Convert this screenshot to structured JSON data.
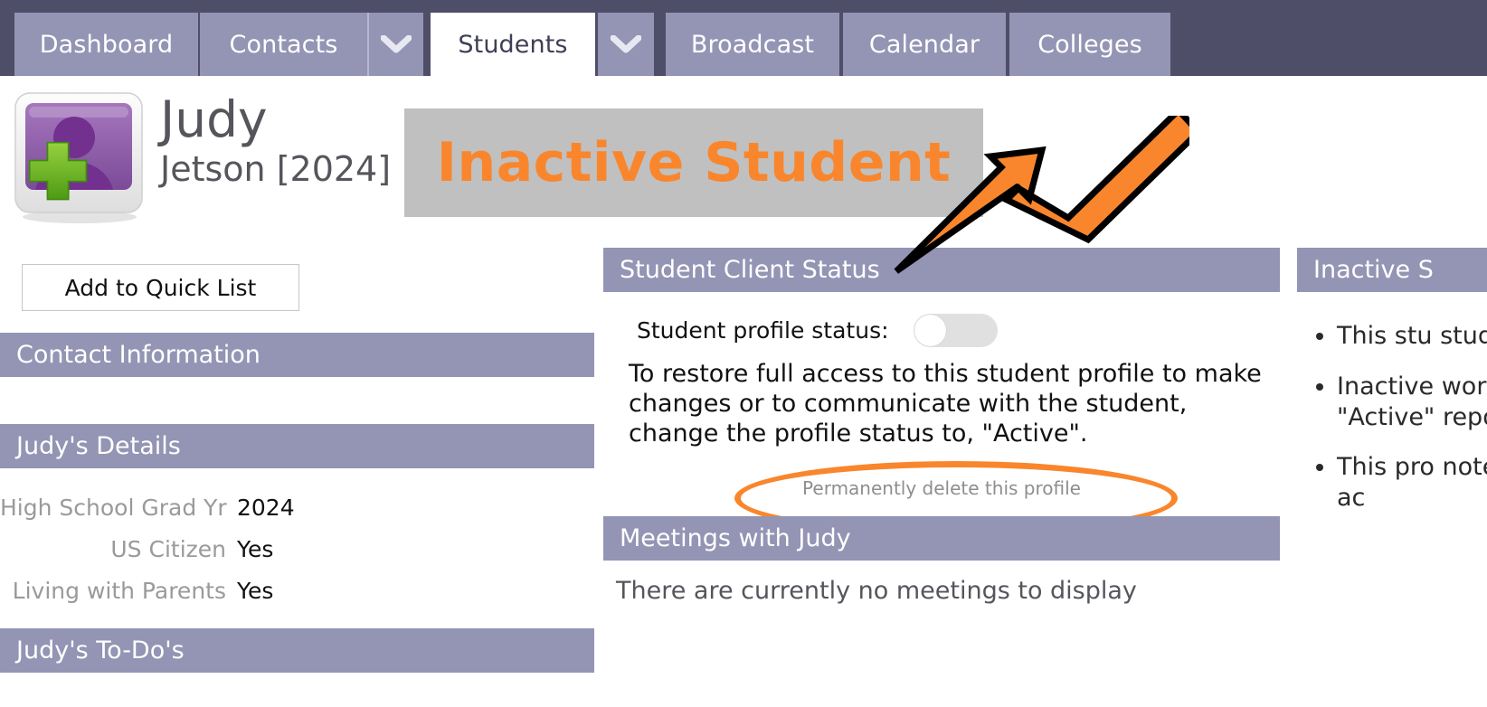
{
  "nav": {
    "tabs": [
      {
        "label": "Dashboard",
        "active": false,
        "caret": false
      },
      {
        "label": "Contacts",
        "active": false,
        "caret": true
      },
      {
        "label": "Students",
        "active": true,
        "caret": true
      },
      {
        "label": "Broadcast",
        "active": false,
        "caret": false
      },
      {
        "label": "Calendar",
        "active": false,
        "caret": false
      },
      {
        "label": "Colleges",
        "active": false,
        "caret": false
      }
    ],
    "caret_icon": "chevron-down-icon"
  },
  "header": {
    "avatar_icon": "user-add-avatar-icon",
    "first_name": "Judy",
    "last_name_year": "Jetson [2024]",
    "status_banner": "Inactive Student"
  },
  "left_column": {
    "add_to_quick_list": "Add to Quick List",
    "contact_information_header": "Contact Information",
    "details_header": "Judy's Details",
    "details": [
      {
        "label": "High School Grad Yr",
        "value": "2024"
      },
      {
        "label": "US Citizen",
        "value": "Yes"
      },
      {
        "label": "Living with Parents",
        "value": "Yes"
      }
    ],
    "todos_header": "Judy's To-Do's"
  },
  "center_column": {
    "client_status_header": "Student Client Status",
    "profile_status_label": "Student profile status:",
    "profile_status_value": "off",
    "restore_text": "To restore full access to this student profile to make changes or to communicate with the student, change the profile status to, \"Active\".",
    "delete_link": "Permanently delete this profile",
    "meetings_header": "Meetings with Judy",
    "meetings_empty": "There are currently no meetings to display"
  },
  "right_column": {
    "header": "Inactive S",
    "bullets": [
      "This stu student",
      "Inactive working \"Active\" reports",
      "This pro note, th their ac"
    ]
  },
  "annotations": {
    "arrow_icon": "orange-arrow-icon",
    "ellipse_icon": "orange-ellipse-icon"
  },
  "colors": {
    "nav_background": "#4e4e68",
    "tab": "#9494b4",
    "panel_header": "#9494b4",
    "accent_orange": "#f9862c",
    "banner_gray": "#c0c0c0"
  }
}
